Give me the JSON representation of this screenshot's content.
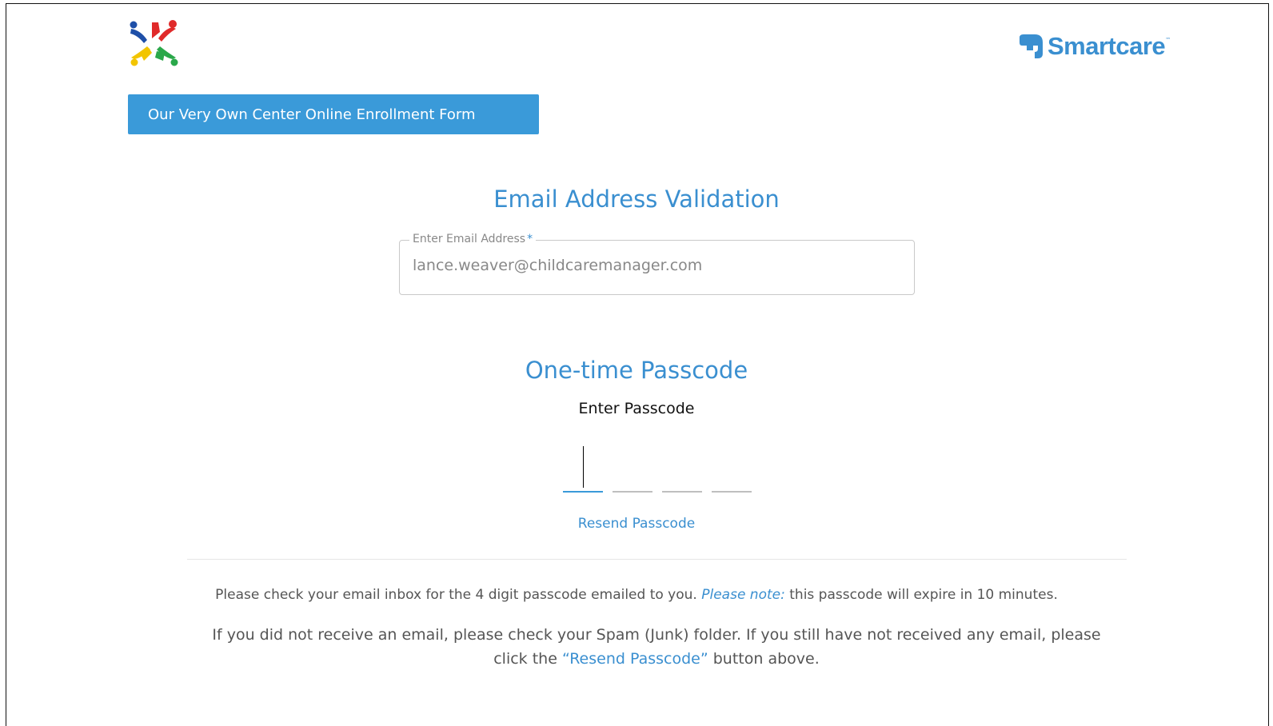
{
  "header": {
    "brand_name": "Smartcare",
    "brand_tm": "™",
    "form_title": "Our Very Own Center Online Enrollment Form"
  },
  "email_section": {
    "title": "Email Address Validation",
    "field_label": "Enter Email Address",
    "required_mark": "*",
    "value": "lance.weaver@childcaremanager.com"
  },
  "passcode_section": {
    "title": "One-time Passcode",
    "label": "Enter Passcode",
    "digits": [
      "",
      "",
      "",
      ""
    ],
    "resend_label": "Resend Passcode"
  },
  "info": {
    "line1_part1": "Please check your email inbox for the 4 digit passcode emailed to you.",
    "line1_note": "Please note:",
    "line1_part2": "this passcode will expire in 10 minutes.",
    "line2_part1": "If you did not receive an email, please check your Spam (Junk) folder. If you still have not received any email, please click the",
    "line2_link": "“Resend Passcode”",
    "line2_part2": "button above."
  },
  "colors": {
    "accent": "#3a8fd0",
    "banner": "#3a9ad9"
  }
}
